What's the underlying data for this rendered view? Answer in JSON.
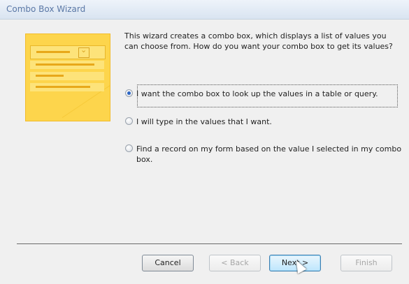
{
  "window": {
    "title": "Combo Box Wizard"
  },
  "intro_text": "This wizard creates a combo box, which displays a list of values you can choose from.  How do you want your combo box to get its values?",
  "options": [
    {
      "label": "I want the combo box to look up the values in a table or query.",
      "checked": true
    },
    {
      "label": "I will type in the values that I want.",
      "checked": false
    },
    {
      "label": "Find a record on my form based on the value I selected in my combo box.",
      "checked": false
    }
  ],
  "buttons": {
    "cancel": "Cancel",
    "back": "< Back",
    "next": "Next >",
    "finish": "Finish"
  },
  "icons": [
    "combo-box-illustration-icon",
    "mouse-cursor-icon"
  ]
}
